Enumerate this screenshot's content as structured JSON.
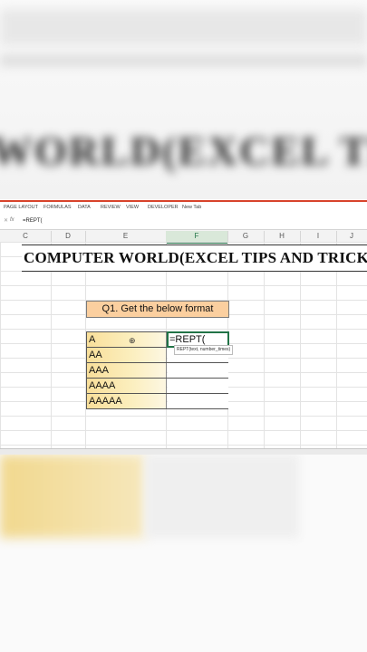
{
  "ribbon": {
    "tabs": [
      "PAGE LAYOUT",
      "FORMULAS",
      "DATA",
      "REVIEW",
      "VIEW",
      "DEVELOPER",
      "New Tab"
    ]
  },
  "formula_bar": {
    "fx_label": "fx",
    "formula": "=REPT("
  },
  "columns": [
    "C",
    "D",
    "E",
    "F",
    "G",
    "H",
    "I",
    "J"
  ],
  "sheet": {
    "title": "COMPUTER WORLD(EXCEL TIPS AND TRICKS)",
    "question": "Q1. Get the below format",
    "rows": [
      {
        "e": "A",
        "f": "=REPT("
      },
      {
        "e": "AA",
        "f": ""
      },
      {
        "e": "AAA",
        "f": ""
      },
      {
        "e": "AAAA",
        "f": ""
      },
      {
        "e": "AAAAA",
        "f": ""
      }
    ],
    "tooltip": "REPT(text, number_times)"
  },
  "colors": {
    "accent": "#217346",
    "ribbon_border": "#d8432b",
    "question_fill": "#fbcf9f",
    "cell_fill": "#f9df9a"
  }
}
